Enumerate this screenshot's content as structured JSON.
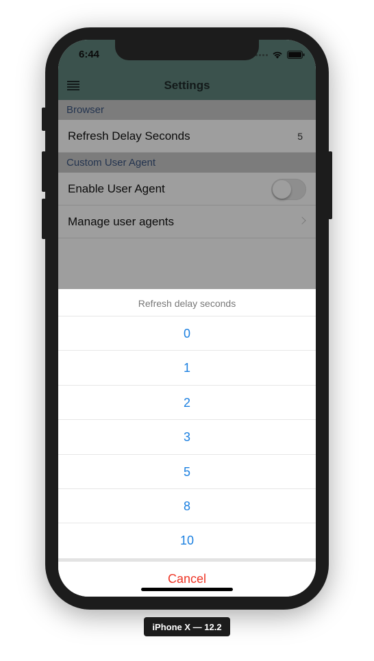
{
  "status_bar": {
    "time": "6:44"
  },
  "nav": {
    "title": "Settings"
  },
  "sections": [
    {
      "header": "Browser",
      "rows": [
        {
          "label": "Refresh Delay Seconds",
          "value": "5"
        }
      ]
    },
    {
      "header": "Custom User Agent",
      "rows": [
        {
          "label": "Enable User Agent",
          "toggle_on": false
        },
        {
          "label": "Manage user agents"
        }
      ]
    }
  ],
  "action_sheet": {
    "title": "Refresh delay seconds",
    "options": [
      "0",
      "1",
      "2",
      "3",
      "5",
      "8",
      "10"
    ],
    "cancel": "Cancel"
  },
  "device_label": "iPhone X — 12.2",
  "colors": {
    "nav_bg": "#5f857c",
    "option_blue": "#1a7fe0",
    "cancel_red": "#ee3526",
    "section_text": "#3a5580"
  }
}
